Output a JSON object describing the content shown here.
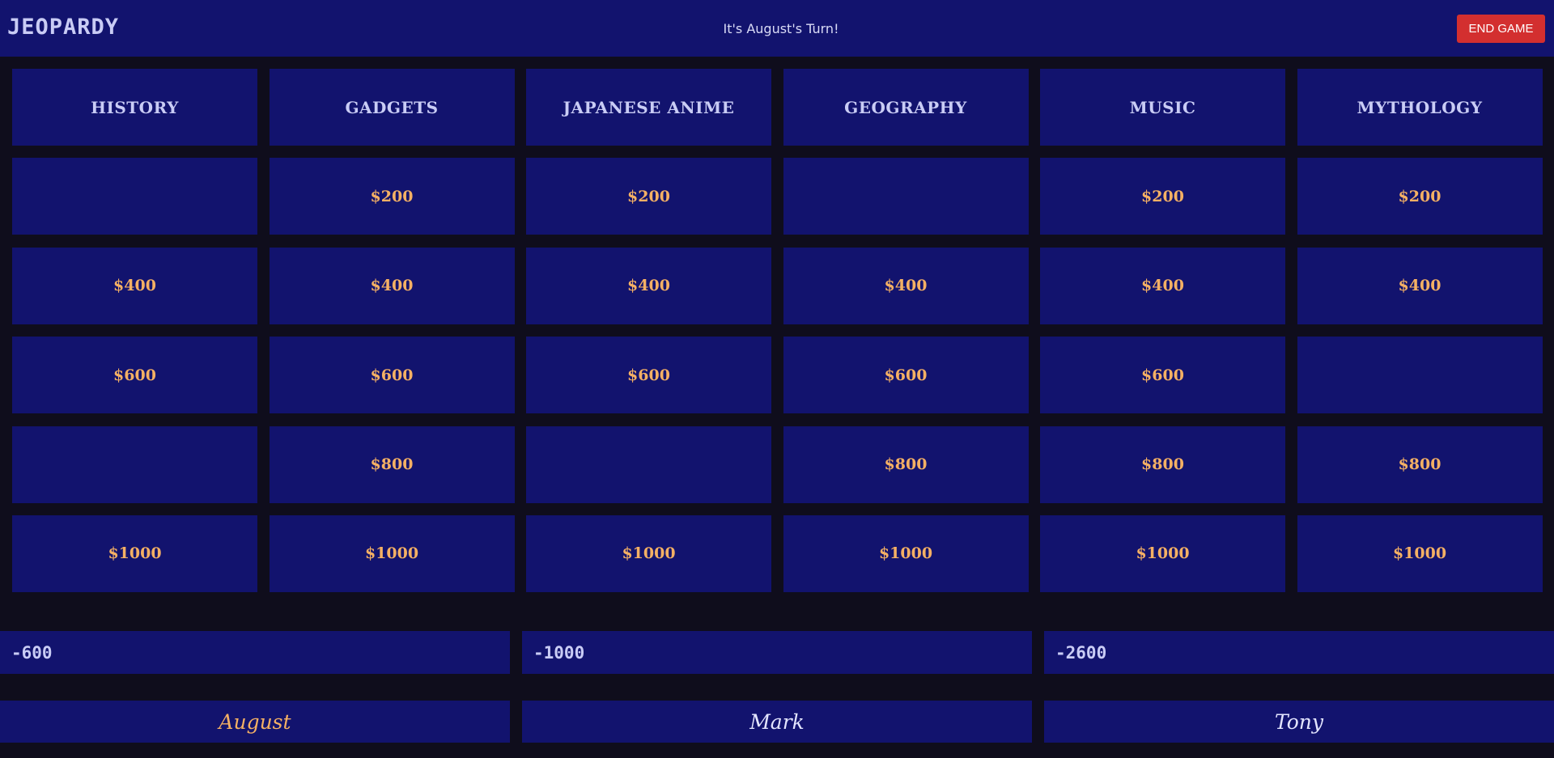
{
  "header": {
    "logo": "JEOPARDY",
    "turn_text": "It's August's Turn!",
    "end_button": "END GAME"
  },
  "colors": {
    "board_blue": "#12136e",
    "background": "#0f0d1c",
    "value_gold": "#f4b064",
    "end_button_red": "#d32f2f"
  },
  "board": {
    "categories": [
      "HISTORY",
      "GADGETS",
      "JAPANESE ANIME",
      "GEOGRAPHY",
      "MUSIC",
      "MYTHOLOGY"
    ],
    "rows": [
      [
        "",
        "$200",
        "$200",
        "",
        "$200",
        "$200"
      ],
      [
        "$400",
        "$400",
        "$400",
        "$400",
        "$400",
        "$400"
      ],
      [
        "$600",
        "$600",
        "$600",
        "$600",
        "$600",
        ""
      ],
      [
        "",
        "$800",
        "",
        "$800",
        "$800",
        "$800"
      ],
      [
        "$1000",
        "$1000",
        "$1000",
        "$1000",
        "$1000",
        "$1000"
      ]
    ]
  },
  "players": [
    {
      "name": "August",
      "score": "-600",
      "active": true
    },
    {
      "name": "Mark",
      "score": "-1000",
      "active": false
    },
    {
      "name": "Tony",
      "score": "-2600",
      "active": false
    }
  ]
}
